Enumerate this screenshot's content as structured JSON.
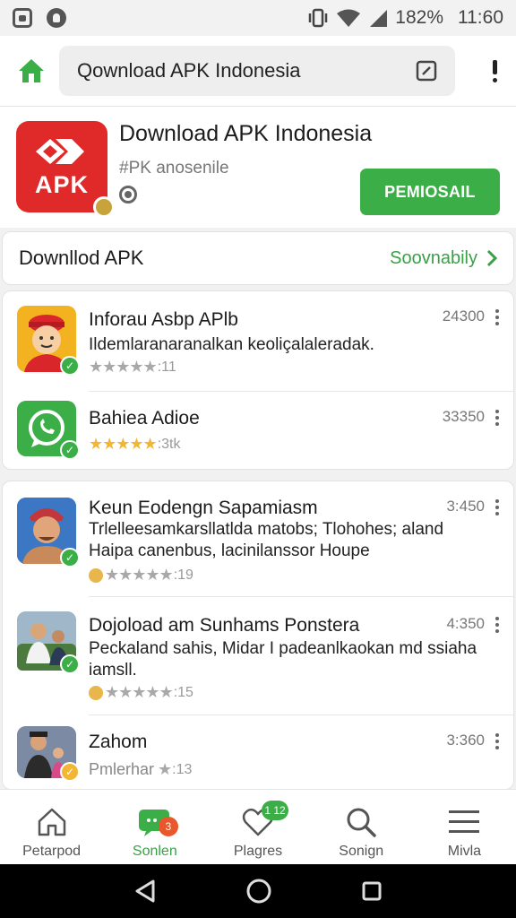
{
  "status_bar": {
    "battery": "182%",
    "time": "11:60",
    "left_icons": [
      "screenshot-icon",
      "notification-icon"
    ],
    "right_icons": [
      "vibrate-icon",
      "wifi-icon",
      "signal-icon"
    ]
  },
  "header": {
    "search_value": "Qownload APK Indonesia",
    "home_icon": "home-icon",
    "edit_icon": "edit-icon",
    "more_icon": "exclamation-more-icon"
  },
  "app": {
    "logo_text": "APK",
    "title": "Download APK Indonesia",
    "subtitle": "#PK anosenile",
    "install_label": "PEMIOSAIL"
  },
  "download_row": {
    "title": "Downllod APK",
    "link_label": "Soovnabily"
  },
  "list_primary": [
    {
      "title": "Inforau Asbp APlb",
      "description": "Ildemlaranaranalkan keoliçalaleradak.",
      "stars": "★★★★★",
      "rating": ":11",
      "count": "24300",
      "icon": "delivery-avatar-icon"
    },
    {
      "title": "Bahiea Adioe",
      "description": "",
      "stars": "★★★★★",
      "rating": ":3tk",
      "count": "33350",
      "icon": "whatsapp-icon"
    }
  ],
  "list_secondary": [
    {
      "title": "Keun Eodengn Sapamiasm",
      "description": "Trlelleesamkarsllatlda matobs; Tlohohes; aland Haipa canenbus, lacinilanssor Houpe",
      "stars": "★★★★★",
      "rating": ":19",
      "count": "3:450",
      "icon": "person-avatar-icon"
    },
    {
      "title": "Dojoload am Sunhams Ponstera",
      "description": "Peckaland sahis, Midar I padeanlkaokan md ssiaha iamsll.",
      "stars": "★★★★★",
      "rating": ":15",
      "count": "4:350",
      "icon": "photo-avatar-icon"
    },
    {
      "title": "Zahom",
      "description": "",
      "prefix": "Pmlerhar",
      "stars": "★",
      "rating": ":13",
      "count": "3:360",
      "icon": "group-photo-icon"
    }
  ],
  "bottom_nav": [
    {
      "label": "Petarpod",
      "icon": "home-outline-icon",
      "active": false
    },
    {
      "label": "Sonlen",
      "icon": "chat-icon",
      "active": true,
      "badge": "3"
    },
    {
      "label": "Plagres",
      "icon": "heart-icon",
      "active": false,
      "badge": "1 12"
    },
    {
      "label": "Sonign",
      "icon": "search-icon",
      "active": false
    },
    {
      "label": "Mivla",
      "icon": "menu-icon",
      "active": false
    }
  ],
  "colors": {
    "accent_green": "#3cae48",
    "apk_red": "#e02a2a",
    "text_dark": "#1c1c1c"
  }
}
